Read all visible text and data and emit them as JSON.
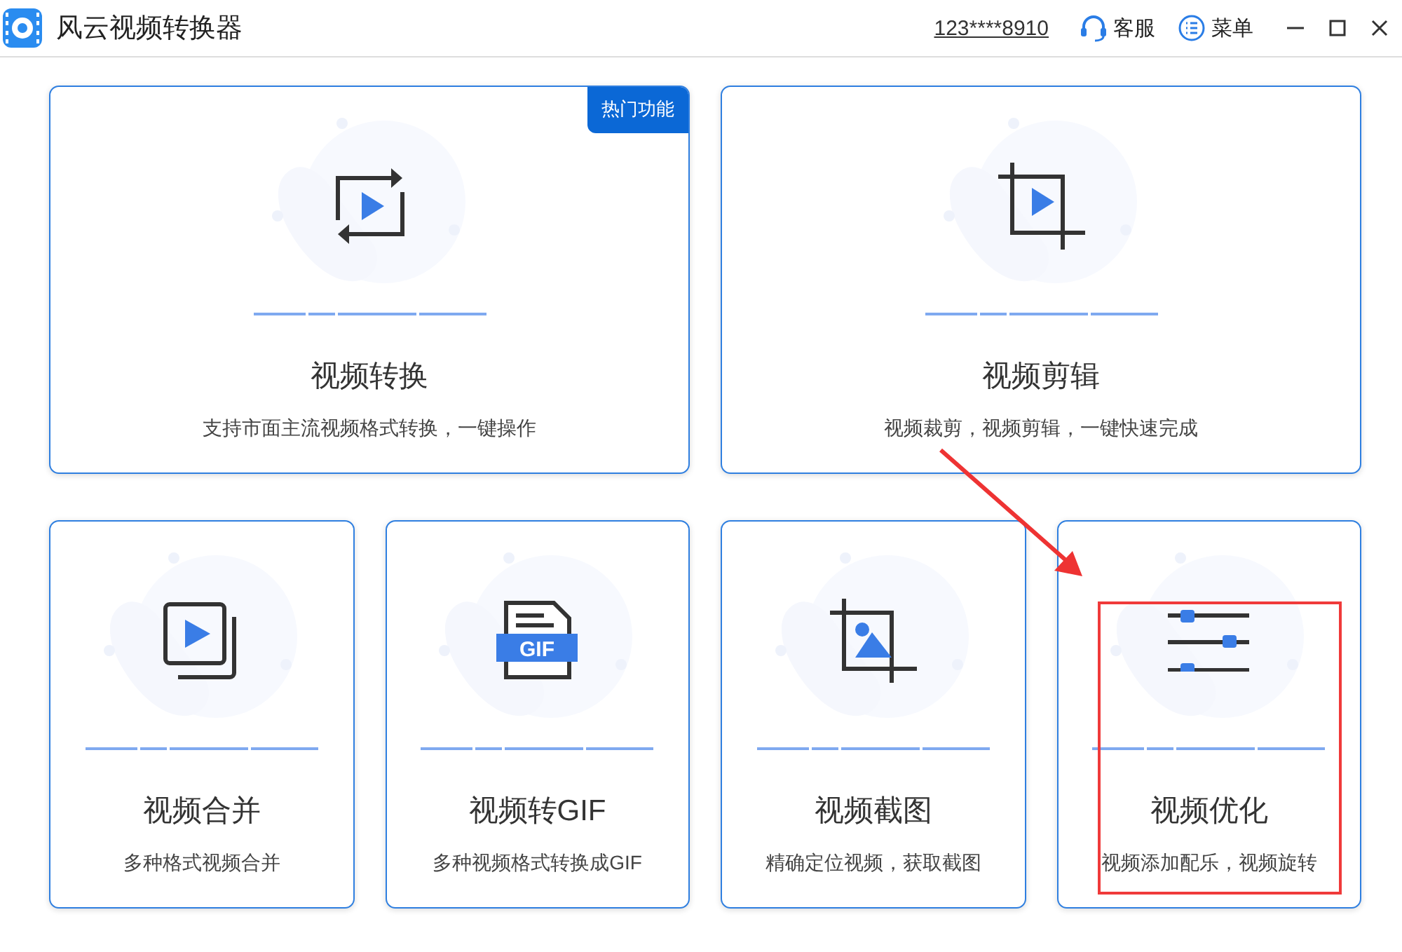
{
  "window": {
    "title": "风云视频转换器",
    "account": "123****8910",
    "service": "客服",
    "menu": "菜单"
  },
  "top_cards": [
    {
      "kind": "convert",
      "title": "视频转换",
      "description": "支持市面主流视频格式转换，一键操作",
      "badge": "热门功能"
    },
    {
      "kind": "crop",
      "title": "视频剪辑",
      "description": "视频裁剪，视频剪辑，一键快速完成"
    }
  ],
  "bottom_cards": [
    {
      "kind": "merge",
      "title": "视频合并",
      "description": "多种格式视频合并"
    },
    {
      "kind": "gif",
      "icon_label": "GIF",
      "title": "视频转GIF",
      "description": "多种视频格式转换成GIF"
    },
    {
      "kind": "screenshot",
      "title": "视频截图",
      "description": "精确定位视频，获取截图"
    },
    {
      "kind": "sliders",
      "title": "视频优化",
      "description": "视频添加配乐，视频旋转"
    }
  ],
  "annotations": {
    "arrow": true,
    "highlight_box": true
  }
}
